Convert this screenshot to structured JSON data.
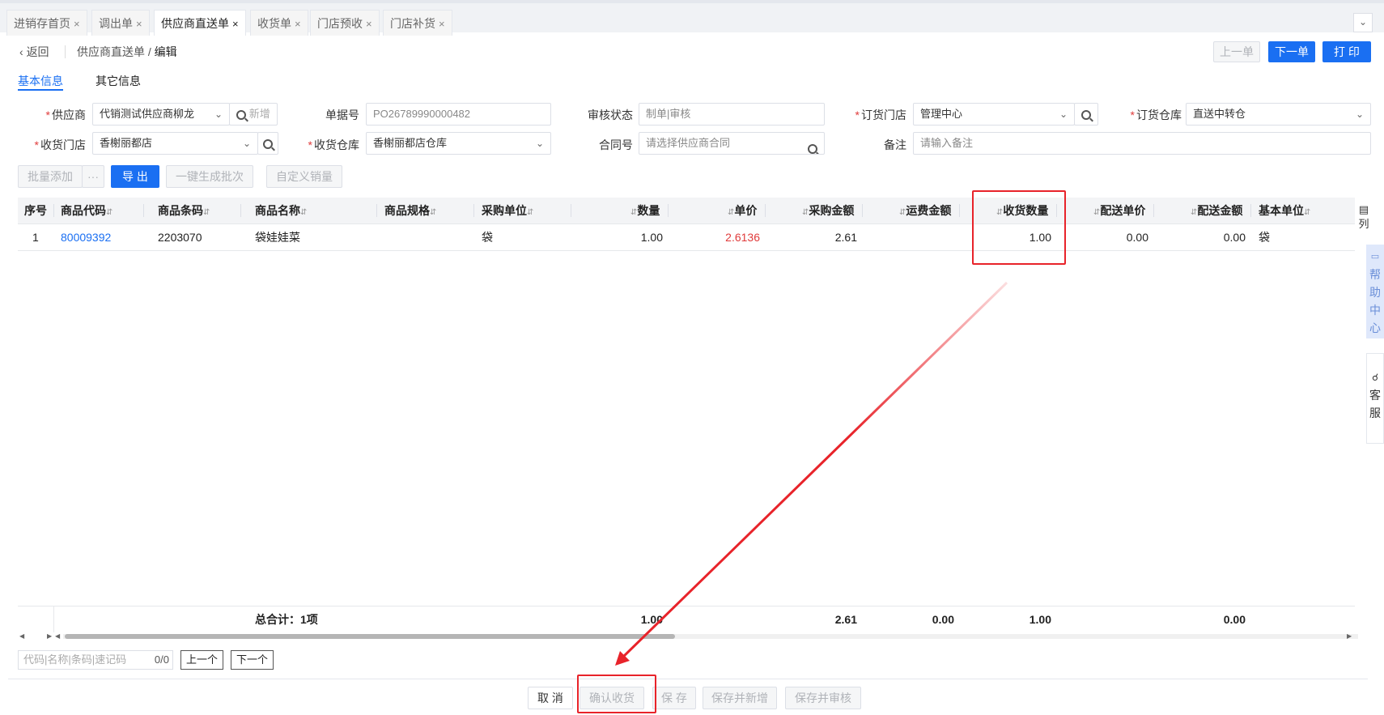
{
  "tabs": [
    {
      "label": "进销存首页",
      "close": "×"
    },
    {
      "label": "调出单",
      "close": "×"
    },
    {
      "label": "供应商直送单",
      "close": "×"
    },
    {
      "label": "收货单",
      "close": "×"
    },
    {
      "label": "门店预收",
      "close": "×"
    },
    {
      "label": "门店补货",
      "close": "×"
    }
  ],
  "active_tab": "供应商直送单",
  "header": {
    "back_label": "返回",
    "breadcrumb_parent": "供应商直送单",
    "breadcrumb_sep": "/",
    "breadcrumb_current": "编辑",
    "prev_label": "上一单",
    "next_label": "下一单",
    "print_label": "打 印"
  },
  "subtabs": [
    "基本信息",
    "其它信息"
  ],
  "form": {
    "supplier_label": "供应商",
    "supplier_value": "代销测试供应商柳龙",
    "supplier_new": "新增",
    "doc_no_label": "单据号",
    "doc_no_value": "PO26789990000482",
    "audit_label": "审核状态",
    "audit_value": "制单|审核",
    "order_store_label": "订货门店",
    "order_store_value": "管理中心",
    "order_wh_label": "订货仓库",
    "order_wh_value": "直送中转仓",
    "recv_store_label": "收货门店",
    "recv_store_value": "香榭丽都店",
    "recv_wh_label": "收货仓库",
    "recv_wh_value": "香榭丽都店仓库",
    "contract_label": "合同号",
    "contract_placeholder": "请选择供应商合同",
    "remark_label": "备注",
    "remark_placeholder": "请输入备注"
  },
  "toolbar": {
    "batch_add": "批量添加",
    "more": "···",
    "export": "导 出",
    "gen_batch": "一键生成批次",
    "custom_sales": "自定义销量"
  },
  "table": {
    "columns": [
      "序号",
      "商品代码",
      "商品条码",
      "商品名称",
      "商品规格",
      "采购单位",
      "数量",
      "单价",
      "采购金额",
      "运费金额",
      "收货数量",
      "配送单价",
      "配送金额",
      "基本单位"
    ],
    "rows": [
      {
        "seq": "1",
        "code": "80009392",
        "barcode": "2203070",
        "name": "袋娃娃菜",
        "spec": "",
        "unit": "袋",
        "qty": "1.00",
        "price": "2.6136",
        "amount": "2.61",
        "freight": "",
        "recv_qty": "1.00",
        "dist_price": "0.00",
        "dist_amount": "0.00",
        "base_unit": "袋"
      }
    ],
    "summary": {
      "label": "总合计：1项",
      "qty": "1.00",
      "amount": "2.61",
      "freight": "0.00",
      "recv_qty": "1.00",
      "dist_amount": "0.00"
    }
  },
  "side": {
    "columns_label": "列",
    "help_label": "帮助中心",
    "service_label": "客服"
  },
  "find": {
    "placeholder": "代码|名称|条码|速记码",
    "count": "0/0",
    "prev": "上一个",
    "next": "下一个"
  },
  "footer": {
    "cancel": "取 消",
    "confirm": "确认收货",
    "save": "保 存",
    "save_new": "保存并新增",
    "save_audit": "保存并审核"
  },
  "colors": {
    "primary": "#1a6ff2",
    "annotation": "#e8232a",
    "price_red": "#e03b3b"
  }
}
